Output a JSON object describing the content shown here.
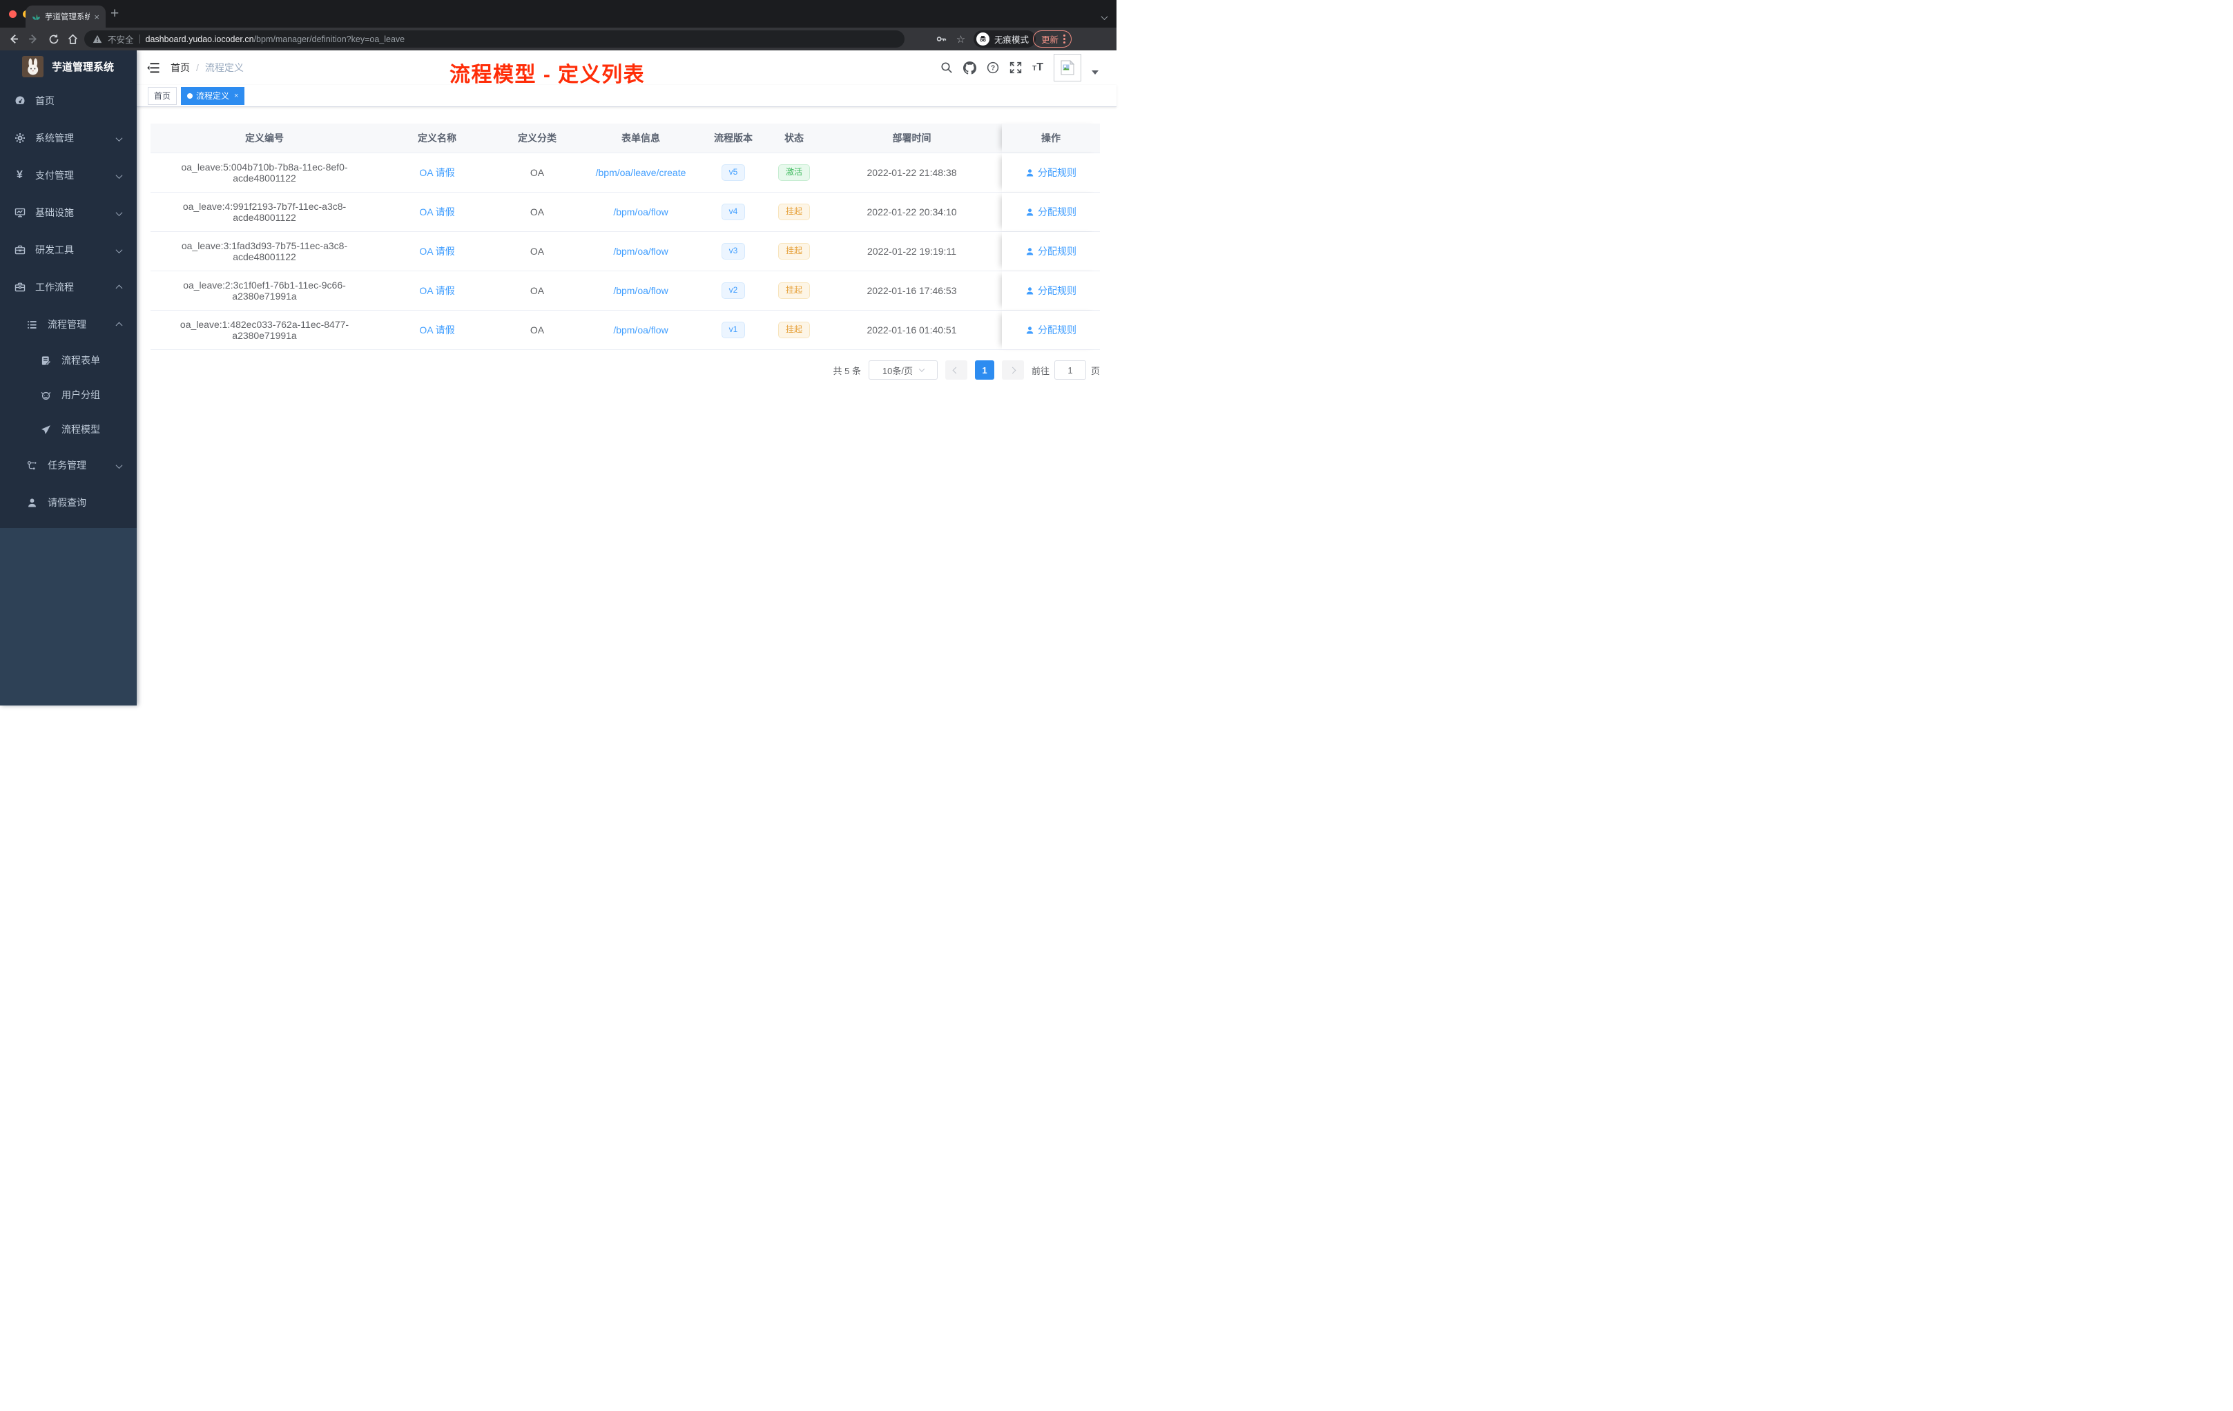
{
  "browser": {
    "tab_title": "芋道管理系统",
    "tab_close": "×",
    "new_tab": "+",
    "omnibox": {
      "insecure_label": "不安全",
      "host": "dashboard.yudao.iocoder.cn",
      "path": "/bpm/manager/definition?key=oa_leave"
    },
    "incognito_label": "无痕模式",
    "update_label": "更新"
  },
  "sidebar": {
    "app_title": "芋道管理系统",
    "menu": [
      {
        "label": "首页",
        "icon": "dashboard-icon"
      },
      {
        "label": "系统管理",
        "icon": "gear-icon"
      },
      {
        "label": "支付管理",
        "icon": "yen-icon"
      },
      {
        "label": "基础设施",
        "icon": "monitor-icon"
      },
      {
        "label": "研发工具",
        "icon": "toolbox-icon"
      },
      {
        "label": "工作流程",
        "icon": "briefcase-icon"
      },
      {
        "label": "流程管理",
        "icon": "list-icon"
      },
      {
        "label": "流程表单",
        "icon": "form-icon"
      },
      {
        "label": "用户分组",
        "icon": "user-group-icon"
      },
      {
        "label": "流程模型",
        "icon": "paper-plane-icon"
      },
      {
        "label": "任务管理",
        "icon": "flow-icon"
      },
      {
        "label": "请假查询",
        "icon": "person-icon"
      }
    ]
  },
  "navbar": {
    "breadcrumb": {
      "home": "首页",
      "separator": "/",
      "current": "流程定义"
    }
  },
  "tags": {
    "home": "首页",
    "active": "流程定义",
    "close": "×"
  },
  "annotation": {
    "text": "流程模型 - 定义列表",
    "color": "#ff2d08"
  },
  "table": {
    "headers": [
      "定义编号",
      "定义名称",
      "定义分类",
      "表单信息",
      "流程版本",
      "状态",
      "部署时间",
      "操作"
    ],
    "rows": [
      {
        "id": "oa_leave:5:004b710b-7b8a-11ec-8ef0-acde48001122",
        "name": "OA 请假",
        "category": "OA",
        "form": "/bpm/oa/leave/create",
        "version": "v5",
        "status": "激活",
        "time": "2022-01-22 21:48:38",
        "action": "分配规则"
      },
      {
        "id": "oa_leave:4:991f2193-7b7f-11ec-a3c8-acde48001122",
        "name": "OA 请假",
        "category": "OA",
        "form": "/bpm/oa/flow",
        "version": "v4",
        "status": "挂起",
        "time": "2022-01-22 20:34:10",
        "action": "分配规则"
      },
      {
        "id": "oa_leave:3:1fad3d93-7b75-11ec-a3c8-acde48001122",
        "name": "OA 请假",
        "category": "OA",
        "form": "/bpm/oa/flow",
        "version": "v3",
        "status": "挂起",
        "time": "2022-01-22 19:19:11",
        "action": "分配规则"
      },
      {
        "id": "oa_leave:2:3c1f0ef1-76b1-11ec-9c66-a2380e71991a",
        "name": "OA 请假",
        "category": "OA",
        "form": "/bpm/oa/flow",
        "version": "v2",
        "status": "挂起",
        "time": "2022-01-16 17:46:53",
        "action": "分配规则"
      },
      {
        "id": "oa_leave:1:482ec033-762a-11ec-8477-a2380e71991a",
        "name": "OA 请假",
        "category": "OA",
        "form": "/bpm/oa/flow",
        "version": "v1",
        "status": "挂起",
        "time": "2022-01-16 01:40:51",
        "action": "分配规则"
      }
    ]
  },
  "pagination": {
    "total": "共 5 条",
    "page_size": "10条/页",
    "current_page": "1",
    "goto_label": "前往",
    "goto_value": "1",
    "page_unit": "页"
  },
  "colors": {
    "accent": "#2d8cf0",
    "link": "#409EFF",
    "status_active": "#3cb95c",
    "status_suspended": "#e6a23c",
    "annotation_red": "#ff2d08",
    "sidebar_bg": "#2e4156",
    "menu_bg": "#222e3f",
    "table_header_bg": "#f7f8fa"
  }
}
